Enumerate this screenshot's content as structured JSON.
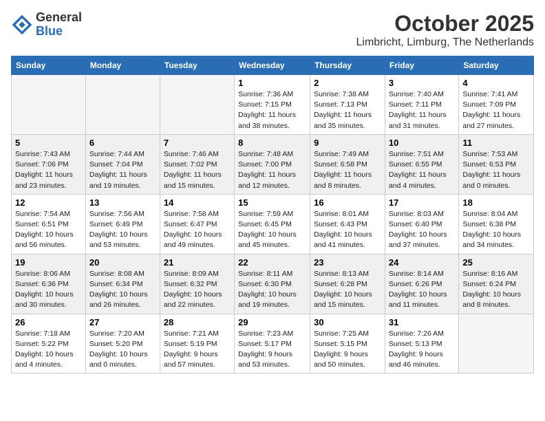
{
  "header": {
    "logo_general": "General",
    "logo_blue": "Blue",
    "title": "October 2025",
    "subtitle": "Limbricht, Limburg, The Netherlands"
  },
  "days_of_week": [
    "Sunday",
    "Monday",
    "Tuesday",
    "Wednesday",
    "Thursday",
    "Friday",
    "Saturday"
  ],
  "weeks": [
    [
      {
        "num": "",
        "info": ""
      },
      {
        "num": "",
        "info": ""
      },
      {
        "num": "",
        "info": ""
      },
      {
        "num": "1",
        "info": "Sunrise: 7:36 AM\nSunset: 7:15 PM\nDaylight: 11 hours\nand 38 minutes."
      },
      {
        "num": "2",
        "info": "Sunrise: 7:38 AM\nSunset: 7:13 PM\nDaylight: 11 hours\nand 35 minutes."
      },
      {
        "num": "3",
        "info": "Sunrise: 7:40 AM\nSunset: 7:11 PM\nDaylight: 11 hours\nand 31 minutes."
      },
      {
        "num": "4",
        "info": "Sunrise: 7:41 AM\nSunset: 7:09 PM\nDaylight: 11 hours\nand 27 minutes."
      }
    ],
    [
      {
        "num": "5",
        "info": "Sunrise: 7:43 AM\nSunset: 7:06 PM\nDaylight: 11 hours\nand 23 minutes."
      },
      {
        "num": "6",
        "info": "Sunrise: 7:44 AM\nSunset: 7:04 PM\nDaylight: 11 hours\nand 19 minutes."
      },
      {
        "num": "7",
        "info": "Sunrise: 7:46 AM\nSunset: 7:02 PM\nDaylight: 11 hours\nand 15 minutes."
      },
      {
        "num": "8",
        "info": "Sunrise: 7:48 AM\nSunset: 7:00 PM\nDaylight: 11 hours\nand 12 minutes."
      },
      {
        "num": "9",
        "info": "Sunrise: 7:49 AM\nSunset: 6:58 PM\nDaylight: 11 hours\nand 8 minutes."
      },
      {
        "num": "10",
        "info": "Sunrise: 7:51 AM\nSunset: 6:55 PM\nDaylight: 11 hours\nand 4 minutes."
      },
      {
        "num": "11",
        "info": "Sunrise: 7:53 AM\nSunset: 6:53 PM\nDaylight: 11 hours\nand 0 minutes."
      }
    ],
    [
      {
        "num": "12",
        "info": "Sunrise: 7:54 AM\nSunset: 6:51 PM\nDaylight: 10 hours\nand 56 minutes."
      },
      {
        "num": "13",
        "info": "Sunrise: 7:56 AM\nSunset: 6:49 PM\nDaylight: 10 hours\nand 53 minutes."
      },
      {
        "num": "14",
        "info": "Sunrise: 7:58 AM\nSunset: 6:47 PM\nDaylight: 10 hours\nand 49 minutes."
      },
      {
        "num": "15",
        "info": "Sunrise: 7:59 AM\nSunset: 6:45 PM\nDaylight: 10 hours\nand 45 minutes."
      },
      {
        "num": "16",
        "info": "Sunrise: 8:01 AM\nSunset: 6:43 PM\nDaylight: 10 hours\nand 41 minutes."
      },
      {
        "num": "17",
        "info": "Sunrise: 8:03 AM\nSunset: 6:40 PM\nDaylight: 10 hours\nand 37 minutes."
      },
      {
        "num": "18",
        "info": "Sunrise: 8:04 AM\nSunset: 6:38 PM\nDaylight: 10 hours\nand 34 minutes."
      }
    ],
    [
      {
        "num": "19",
        "info": "Sunrise: 8:06 AM\nSunset: 6:36 PM\nDaylight: 10 hours\nand 30 minutes."
      },
      {
        "num": "20",
        "info": "Sunrise: 8:08 AM\nSunset: 6:34 PM\nDaylight: 10 hours\nand 26 minutes."
      },
      {
        "num": "21",
        "info": "Sunrise: 8:09 AM\nSunset: 6:32 PM\nDaylight: 10 hours\nand 22 minutes."
      },
      {
        "num": "22",
        "info": "Sunrise: 8:11 AM\nSunset: 6:30 PM\nDaylight: 10 hours\nand 19 minutes."
      },
      {
        "num": "23",
        "info": "Sunrise: 8:13 AM\nSunset: 6:28 PM\nDaylight: 10 hours\nand 15 minutes."
      },
      {
        "num": "24",
        "info": "Sunrise: 8:14 AM\nSunset: 6:26 PM\nDaylight: 10 hours\nand 11 minutes."
      },
      {
        "num": "25",
        "info": "Sunrise: 8:16 AM\nSunset: 6:24 PM\nDaylight: 10 hours\nand 8 minutes."
      }
    ],
    [
      {
        "num": "26",
        "info": "Sunrise: 7:18 AM\nSunset: 5:22 PM\nDaylight: 10 hours\nand 4 minutes."
      },
      {
        "num": "27",
        "info": "Sunrise: 7:20 AM\nSunset: 5:20 PM\nDaylight: 10 hours\nand 0 minutes."
      },
      {
        "num": "28",
        "info": "Sunrise: 7:21 AM\nSunset: 5:19 PM\nDaylight: 9 hours\nand 57 minutes."
      },
      {
        "num": "29",
        "info": "Sunrise: 7:23 AM\nSunset: 5:17 PM\nDaylight: 9 hours\nand 53 minutes."
      },
      {
        "num": "30",
        "info": "Sunrise: 7:25 AM\nSunset: 5:15 PM\nDaylight: 9 hours\nand 50 minutes."
      },
      {
        "num": "31",
        "info": "Sunrise: 7:26 AM\nSunset: 5:13 PM\nDaylight: 9 hours\nand 46 minutes."
      },
      {
        "num": "",
        "info": ""
      }
    ]
  ]
}
